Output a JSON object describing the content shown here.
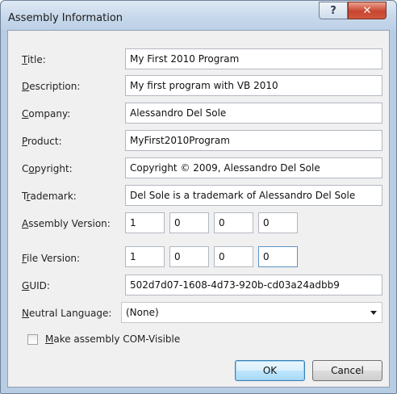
{
  "window": {
    "title": "Assembly Information",
    "help_symbol": "?",
    "close_symbol": "✕"
  },
  "fields": {
    "title": {
      "label_ul": "T",
      "label_rest": "itle:",
      "value": "My First 2010 Program"
    },
    "description": {
      "label_ul": "D",
      "label_rest": "escription:",
      "value": "My first program with VB 2010"
    },
    "company": {
      "label_ul": "C",
      "label_rest": "ompany:",
      "value": "Alessandro Del Sole"
    },
    "product": {
      "label_ul": "P",
      "label_rest": "roduct:",
      "value": "MyFirst2010Program"
    },
    "copyright": {
      "label_pre": "C",
      "label_ul": "o",
      "label_rest": "pyright:",
      "value": "Copyright ©  2009, Alessandro Del Sole"
    },
    "trademark": {
      "label_pre": "T",
      "label_ul": "r",
      "label_rest": "ademark:",
      "value": "Del Sole is a trademark of Alessandro Del Sole"
    },
    "assembly_version": {
      "label_ul": "A",
      "label_rest": "ssembly Version:",
      "values": [
        "1",
        "0",
        "0",
        "0"
      ]
    },
    "file_version": {
      "label_ul": "F",
      "label_rest": "ile Version:",
      "values": [
        "1",
        "0",
        "0",
        "0"
      ]
    },
    "guid": {
      "label_ul": "G",
      "label_rest": "UID:",
      "value": "502d7d07-1608-4d73-920b-cd03a24adbb9"
    },
    "neutral_language": {
      "label_ul": "N",
      "label_rest": "eutral Language:",
      "value": "(None)"
    }
  },
  "com_visible": {
    "label_ul": "M",
    "label_rest": "ake assembly COM-Visible",
    "checked": false
  },
  "buttons": {
    "ok": "OK",
    "cancel": "Cancel"
  }
}
